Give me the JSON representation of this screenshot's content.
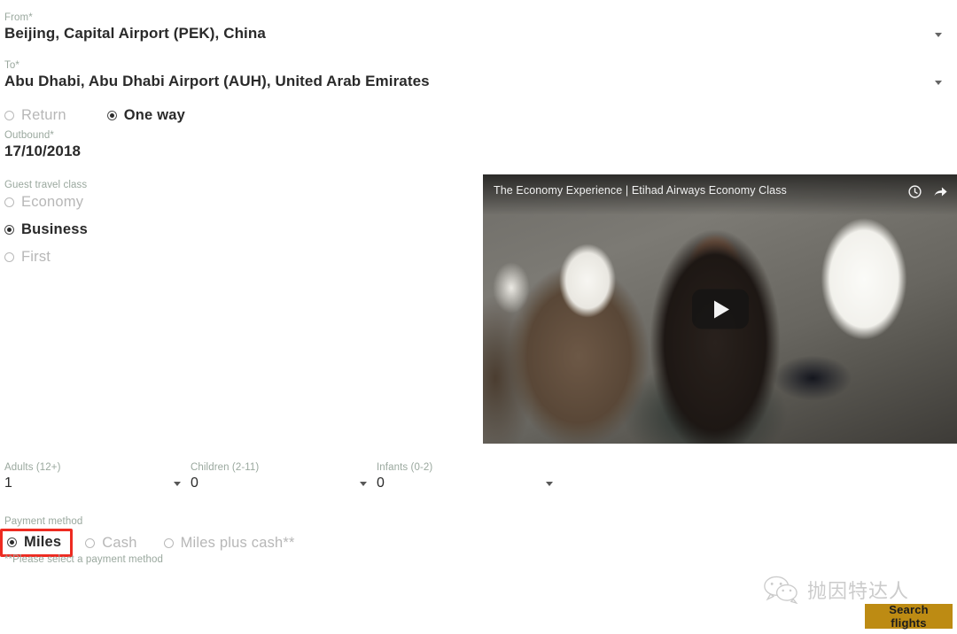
{
  "form": {
    "from": {
      "label": "From*",
      "value": "Beijing, Capital Airport (PEK), China"
    },
    "to": {
      "label": "To*",
      "value": "Abu Dhabi, Abu Dhabi Airport (AUH), United Arab Emirates"
    },
    "trip_type": {
      "options": [
        {
          "label": "Return",
          "selected": false
        },
        {
          "label": "One way",
          "selected": true
        }
      ]
    },
    "outbound": {
      "label": "Outbound*",
      "value": "17/10/2018"
    },
    "travel_class": {
      "label": "Guest travel class",
      "options": [
        {
          "label": "Economy",
          "selected": false
        },
        {
          "label": "Business",
          "selected": true
        },
        {
          "label": "First",
          "selected": false
        }
      ]
    },
    "passengers": [
      {
        "label": "Adults (12+)",
        "value": "1"
      },
      {
        "label": "Children (2-11)",
        "value": "0"
      },
      {
        "label": "Infants (0-2)",
        "value": "0"
      }
    ],
    "payment": {
      "label": "Payment method",
      "options": [
        {
          "label": "Miles",
          "selected": true,
          "highlighted": true
        },
        {
          "label": "Cash",
          "selected": false,
          "highlighted": false
        },
        {
          "label": "Miles plus cash**",
          "selected": false,
          "highlighted": false
        }
      ],
      "note": "**Please select a payment method",
      "highlight_color": "#ee2b21"
    },
    "search_button": {
      "label": "Search flights",
      "color": "#bd8b13"
    }
  },
  "video": {
    "title": "The Economy Experience | Etihad Airways Economy Class",
    "watch_later_icon": "clock-icon",
    "share_icon": "share-icon",
    "play_icon": "play-icon"
  },
  "watermark": {
    "icon": "wechat-icon",
    "text": "抛因特达人"
  }
}
